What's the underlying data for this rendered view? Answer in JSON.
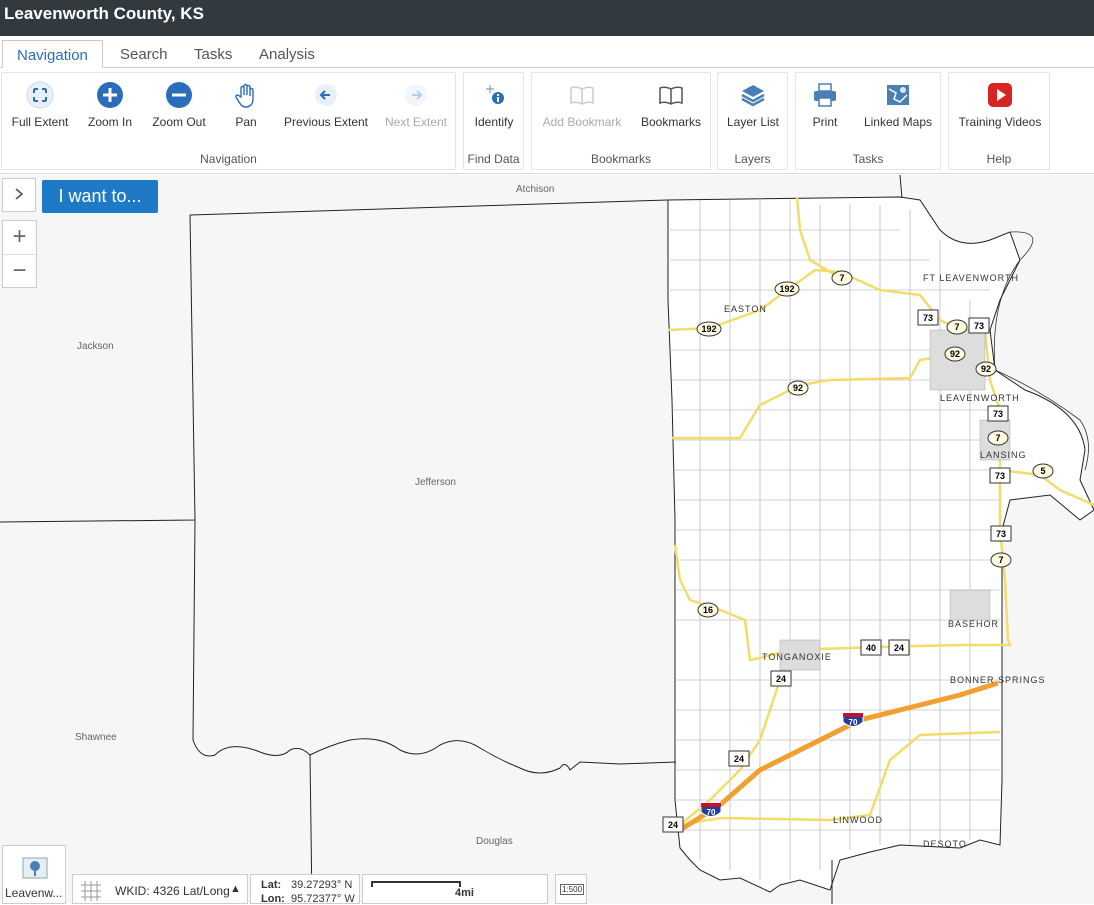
{
  "app": {
    "title": "Leavenworth County, KS"
  },
  "tabs": [
    {
      "label": "Navigation",
      "active": true
    },
    {
      "label": "Search",
      "active": false
    },
    {
      "label": "Tasks",
      "active": false
    },
    {
      "label": "Analysis",
      "active": false
    }
  ],
  "ribbon": {
    "navigation": {
      "label": "Navigation",
      "full_extent": "Full Extent",
      "zoom_in": "Zoom In",
      "zoom_out": "Zoom Out",
      "pan": "Pan",
      "previous_extent": "Previous Extent",
      "next_extent": "Next Extent"
    },
    "find_data": {
      "label": "Find Data",
      "identify": "Identify"
    },
    "bookmarks": {
      "label": "Bookmarks",
      "add_bookmark": "Add Bookmark",
      "bookmarks": "Bookmarks"
    },
    "layers": {
      "label": "Layers",
      "layer_list": "Layer List"
    },
    "tasks": {
      "label": "Tasks",
      "print": "Print",
      "linked_maps": "Linked Maps"
    },
    "help": {
      "label": "Help",
      "training_videos": "Training Videos"
    }
  },
  "map": {
    "i_want_to": "I want to...",
    "expand_icon": "chevron-right-icon",
    "counties": {
      "atchison": "Atchison",
      "jackson": "Jackson",
      "jefferson": "Jefferson",
      "shawnee": "Shawnee",
      "douglas": "Douglas"
    },
    "towns": {
      "ft_leavenworth": "FT LEAVENWORTH",
      "easton": "EASTON",
      "leavenworth": "LEAVENWORTH",
      "lansing": "LANSING",
      "basehor": "BASEHOR",
      "tonganoxie": "TONGANOXIE",
      "bonner_springs": "BONNER SPRINGS",
      "linwood": "LINWOOD",
      "desoto": "DESOTO"
    },
    "shields": {
      "s7a": "7",
      "s192a": "192",
      "s192b": "192",
      "s73a": "73",
      "s7b": "7",
      "s73b": "73",
      "s92a": "92",
      "s92b": "92",
      "s92c": "92",
      "s73c": "73",
      "s7c": "7",
      "s73d": "73",
      "s5": "5",
      "s73e": "73",
      "s7d": "7",
      "s16": "16",
      "s40": "40",
      "s24a": "24",
      "s24b": "24",
      "s70a": "70",
      "s24c": "24",
      "s70b": "70",
      "s24d": "24"
    },
    "colors": {
      "highway": "#f3dc6b",
      "interstate": "#f0a030",
      "road": "#aaaaaa"
    }
  },
  "footer": {
    "overview_label": "Leavenw...",
    "wkid": "WKID: 4326 Lat/Long",
    "lat_label": "Lat:",
    "lat_value": "39.27293° N",
    "lon_label": "Lon:",
    "lon_value": "95.72377° W",
    "scale_label": "4mi",
    "scale_icon": "1:500"
  }
}
